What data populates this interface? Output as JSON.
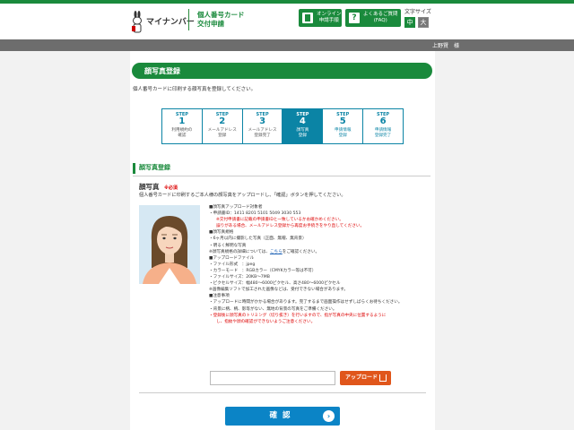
{
  "header": {
    "logo_text": "マイナンバー",
    "app_title_line1": "個人番号カード",
    "app_title_line2": "交付申請",
    "guide_button_line1": "オンライン",
    "guide_button_line2": "申請手順",
    "faq_button_line1": "よくあるご質問",
    "faq_button_line2": "(FAQ)",
    "font_size_label": "文字サイズ",
    "font_size_medium": "中",
    "font_size_small": "大",
    "user_name": "上野賢　様"
  },
  "page": {
    "title": "顔写真登録",
    "intro": "個人番号カードに印刷する顔写真を登録してください。"
  },
  "steps": [
    {
      "label": "STEP",
      "num": "1",
      "name1": "利用規約の",
      "name2": "確認",
      "state": "done"
    },
    {
      "label": "STEP",
      "num": "2",
      "name1": "メールアドレス",
      "name2": "登録",
      "state": "done"
    },
    {
      "label": "STEP",
      "num": "3",
      "name1": "メールアドレス",
      "name2": "登録完了",
      "state": "done"
    },
    {
      "label": "STEP",
      "num": "4",
      "name1": "顔写真",
      "name2": "登録",
      "state": "active"
    },
    {
      "label": "STEP",
      "num": "5",
      "name1": "申請情報",
      "name2": "登録",
      "state": "upcoming"
    },
    {
      "label": "STEP",
      "num": "6",
      "name1": "申請情報",
      "name2": "登録完了",
      "state": "upcoming"
    }
  ],
  "section": {
    "heading": "顔写真登録",
    "photo_label": "顔写真",
    "required": "※必須",
    "photo_desc": "個人番号カードに印刷するご本人様の顔写真をアップロードし、「確認」ボタンを押してください。"
  },
  "notes": {
    "n1": "■顔写真アップロード対象者",
    "n2": "・申請書ID：1411 8201 5101 5049 3030 553",
    "n3": "※交付申請書に記載の申請書IDと一致しているかお確かめください。",
    "n4": "誤りがある場合、メールアドレス登録から再度お手続きをやり直してください。",
    "n5": "■顔写真規格",
    "n6": "・6ヶ月以内に撮影した写真（正面、無帽、無背景）",
    "n7": "・明るく鮮明な写真",
    "n8a": "※顔写真規格の詳細については、",
    "n8link": "こちら",
    "n8b": "をご確認ください。",
    "n9": "■アップロードファイル",
    "n10": "・ファイル形式　：jpeg",
    "n11": "・カラーモード　：RGBカラー（CMYKカラー等は不可）",
    "n12": "・ファイルサイズ：20KB〜7MB",
    "n13": "・ピクセルサイズ：幅480〜6000ピクセル、高さ480〜6000ピクセル",
    "n14": "※画像編集ソフトで加工された画像などは、受付できない場合があります。",
    "n15": "■注意事項",
    "n16": "・アップロードに時間がかかる場合があります。完了するまで画面操作はせずしばらくお待ちください。",
    "n17": "・背景に柄、柄、影等がない、無地の背景の写真をご準備ください。",
    "n18": "・登録後に顔写真のトリミング（切り抜き）を行いますので、指が写真の中央に位置するように",
    "n19": "し、指紋や顔の確認ができないようご注意ください。"
  },
  "upload": {
    "file_value": "",
    "button_label": "アップロード"
  },
  "confirm": {
    "label": "確認",
    "arrow": "›"
  },
  "colors": {
    "brand_green": "#1a8a3c",
    "step_blue": "#0b84a5",
    "upload_orange": "#e0561b",
    "confirm_blue": "#0b84c6",
    "warning_red": "#dd0000"
  }
}
